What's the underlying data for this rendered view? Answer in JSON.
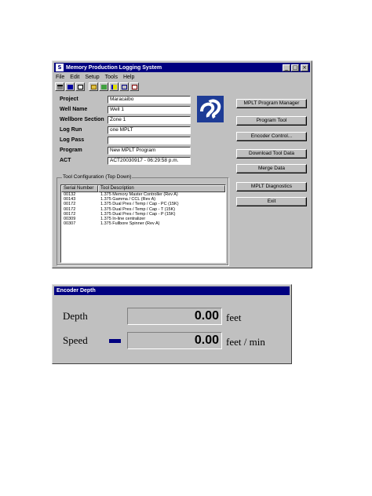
{
  "main_window": {
    "title": "Memory Production Logging System",
    "title_buttons": {
      "minimize": "_",
      "maximize": "□",
      "close": "×"
    },
    "menu": [
      "File",
      "Edit",
      "Setup",
      "Tools",
      "Help"
    ],
    "toolbar_icons": [
      "open-icon",
      "save-icon",
      "print-icon",
      "folder-icon",
      "tools-icon",
      "chart-icon",
      "settings-icon",
      "report-icon"
    ],
    "form": {
      "project": {
        "label": "Project",
        "value": "Maracaibo"
      },
      "well_name": {
        "label": "Well Name",
        "value": "Well 1"
      },
      "wellbore_section": {
        "label": "Wellbore Section",
        "value": "Zone 1"
      },
      "log_run": {
        "label": "Log Run",
        "value": "one MPLT"
      },
      "log_pass": {
        "label": "Log Pass",
        "value": ""
      },
      "program": {
        "label": "Program",
        "value": "New MPLT Program"
      },
      "act": {
        "label": "ACT",
        "value": "ACT20030917 - 06:29:58 p.m."
      }
    },
    "buttons": {
      "program_manager": "MPLT Program Manager",
      "program_tool": "Program Tool",
      "encoder_control": "Encoder Control...",
      "download_tool_data": "Download Tool Data",
      "merge_data": "Merge Data",
      "diagnostics": "MPLT Diagnostics",
      "exit": "Exit"
    },
    "tool_config": {
      "title": "Tool Configuration (Top Down)",
      "columns": [
        "Serial Number",
        "Tool Description"
      ],
      "rows": [
        [
          "00132",
          "1.375 Memory Master Controller (Rev A)"
        ],
        [
          "00143",
          "1.375 Gamma / CCL (Rev A)"
        ],
        [
          "00172",
          "1.375 Dual Pres / Temp / Cap - PC (15K)"
        ],
        [
          "00172",
          "1.375 Dual Pres / Temp / Cap - T (15K)"
        ],
        [
          "00172",
          "1.375 Dual Pres / Temp / Cap - P (15K)"
        ],
        [
          "00309",
          "1.375 In-line centralizer"
        ],
        [
          "00307",
          "1.375 Fullbore Spinner (Rev A)"
        ]
      ]
    }
  },
  "encoder_window": {
    "title": "Encoder Depth",
    "depth": {
      "label": "Depth",
      "value": "0.00",
      "unit": "feet"
    },
    "speed": {
      "label": "Speed",
      "value": "0.00",
      "unit": "feet / min"
    },
    "direction_indicator_color": "#000080"
  }
}
